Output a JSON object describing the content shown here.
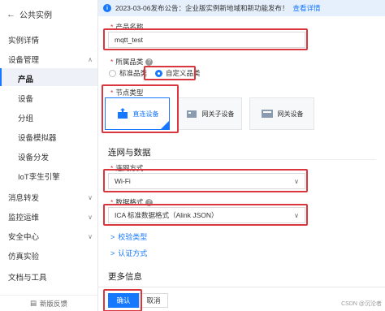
{
  "sidebar": {
    "back_label": "公共实例",
    "items": [
      {
        "label": "实例详情",
        "chevron": ""
      },
      {
        "label": "设备管理",
        "chevron": "∧"
      },
      {
        "label": "产品",
        "chevron": ""
      },
      {
        "label": "设备",
        "chevron": ""
      },
      {
        "label": "分组",
        "chevron": ""
      },
      {
        "label": "设备模拟器",
        "chevron": ""
      },
      {
        "label": "设备分发",
        "chevron": ""
      },
      {
        "label": "IoT孪生引擎",
        "chevron": ""
      },
      {
        "label": "消息转发",
        "chevron": "∨"
      },
      {
        "label": "监控运维",
        "chevron": "∨"
      },
      {
        "label": "安全中心",
        "chevron": "∨"
      },
      {
        "label": "仿真实验",
        "chevron": ""
      },
      {
        "label": "文档与工具",
        "chevron": ""
      }
    ],
    "footer": "新版反馈"
  },
  "notice": {
    "icon": "info-icon",
    "text": "2023-03-06发布公告：企业版实例新地域和新功能发布！",
    "link": "查看详情"
  },
  "form": {
    "product_name_label": "产品名称",
    "product_name_value": "mqtt_test",
    "category_label": "所属品类",
    "category_options": [
      "标准品类",
      "自定义品类"
    ],
    "node_type_label": "节点类型",
    "node_types": [
      "直连设备",
      "网关子设备",
      "网关设备"
    ],
    "network_section": "连网与数据",
    "network_label": "连网方式",
    "network_value": "Wi-Fi",
    "data_format_label": "数据格式",
    "data_format_value": "ICA 标准数据格式（Alink JSON）",
    "verify_type": "校验类型",
    "auth_method": "认证方式",
    "more_info": "更多信息"
  },
  "footer": {
    "confirm": "确认",
    "cancel": "取消",
    "watermark": "CSDN @沉沦者"
  },
  "colors": {
    "accent": "#1677ff",
    "highlight_box": "#d9363e"
  }
}
